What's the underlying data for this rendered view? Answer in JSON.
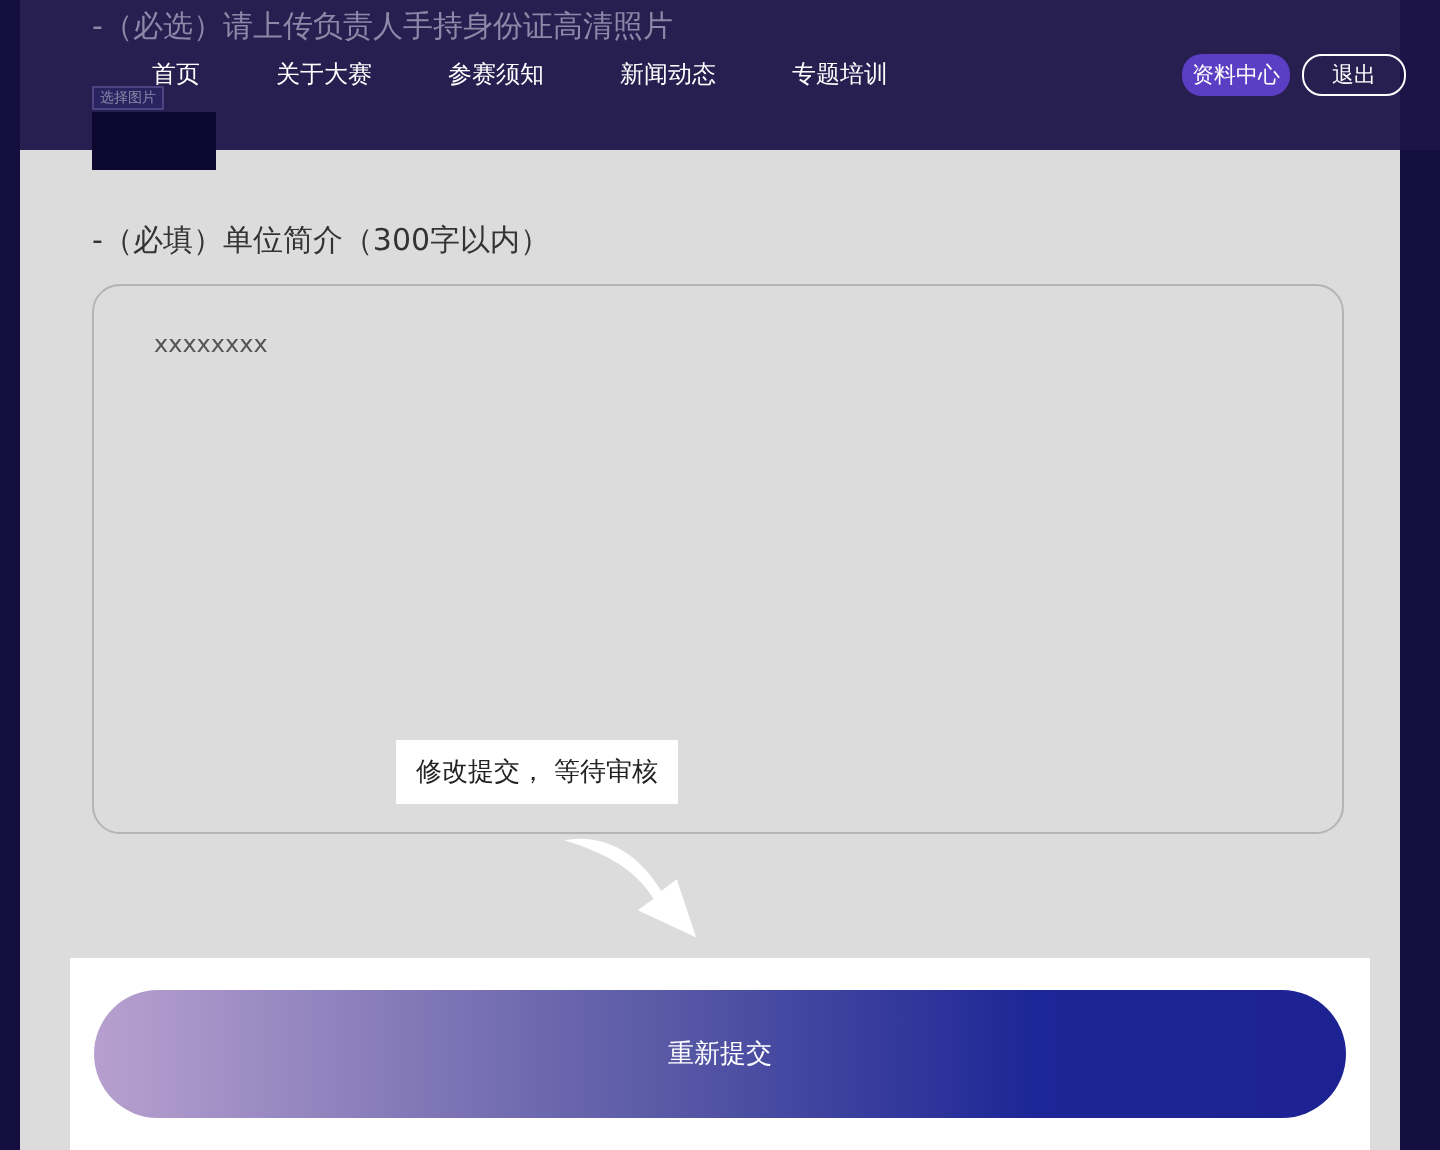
{
  "nav": {
    "items": [
      {
        "label": "首页"
      },
      {
        "label": "关于大赛"
      },
      {
        "label": "参赛须知"
      },
      {
        "label": "新闻动态"
      },
      {
        "label": "专题培训"
      }
    ],
    "resource_button": "资料中心",
    "logout_button": "退出"
  },
  "id_photo": {
    "heading": "-（必选）请上传负责人手持身份证高清照片",
    "choose_button": "选择图片"
  },
  "intro": {
    "heading": "-（必填）单位简介（300字以内）",
    "value": "xxxxxxxx"
  },
  "callout": "修改提交， 等待审核",
  "submit_button": "重新提交"
}
